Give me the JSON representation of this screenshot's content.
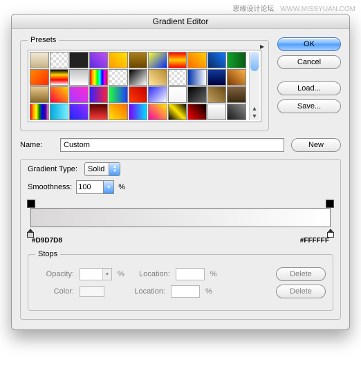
{
  "watermark": {
    "cn": "思缘设计论坛",
    "url": "WWW.MISSYUAN.COM"
  },
  "title": "Gradient Editor",
  "presets_label": "Presets",
  "buttons": {
    "ok": "OK",
    "cancel": "Cancel",
    "load": "Load...",
    "save": "Save...",
    "new": "New",
    "delete": "Delete"
  },
  "name_label": "Name:",
  "name_value": "Custom",
  "gt_label": "Gradient Type:",
  "gt_value": "Solid",
  "smooth_label": "Smoothness:",
  "smooth_value": "100",
  "pct": "%",
  "left_hex": "#D9D7D8",
  "right_hex": "#FFFFFF",
  "stops_label": "Stops",
  "opacity_label": "Opacity:",
  "color_label": "Color:",
  "location_label": "Location:",
  "swatches": [
    "linear-gradient(#f2e9d7,#c7b386)",
    "repeating-conic-gradient(#fff 0 25%,#ddd 0 50%) 0/8px 8px",
    "linear-gradient(#222,#222)",
    "linear-gradient(45deg,#5a2de0,#c64ef0)",
    "linear-gradient(45deg,#ff9a00,#ffe200)",
    "linear-gradient(#aa7f1a,#6a4500)",
    "linear-gradient(135deg,#ffff33,#002aff)",
    "linear-gradient(#ff0000,#ffcc00,#ff0000)",
    "linear-gradient(45deg,#ff6a00,#ffd000)",
    "linear-gradient(45deg,#0a2a60,#1478ff)",
    "linear-gradient(90deg,#13a02a,#0a5a16)",
    "linear-gradient(135deg,#ff8a00,#ff2d00)",
    "linear-gradient(#000,#ffd800,#f00,#fff)",
    "linear-gradient(#c0c0c0,#fff)",
    "linear-gradient(90deg,red,orange,yellow,lime,cyan,blue,magenta,red)",
    "repeating-conic-gradient(#fff 0 25%,#ddd 0 50%) 0/8px 8px",
    "linear-gradient(135deg,#000,#fff)",
    "linear-gradient(45deg,#ffe6a0,#b98b2c)",
    "repeating-conic-gradient(#fff 0 25%,#ddd 0 50%) 0/8px 8px",
    "linear-gradient(90deg,#0033aa,#fff)",
    "linear-gradient(#103a9a,#000040)",
    "linear-gradient(45deg,#7a3a00,#ffb24d)",
    "linear-gradient(#e6c68a,#8a6a2a)",
    "linear-gradient(45deg,#ff0040,#ffd200)",
    "linear-gradient(45deg,#a63aff,#ff2ad4)",
    "linear-gradient(90deg,#3a1fff,#ff1f3a)",
    "linear-gradient(90deg,#1fff3a,#1f3aff)",
    "linear-gradient(45deg,#ff3a00,#c40000)",
    "linear-gradient(135deg,#2a2aff,#fff)",
    "linear-gradient(#fff,#f5f5f5)",
    "linear-gradient(135deg,#000,#666)",
    "linear-gradient(45deg,#c0a060,#6b4a12)",
    "linear-gradient(#806040,#3a2a10)",
    "linear-gradient(90deg,red,orange,yellow,green,blue,indigo,violet)",
    "linear-gradient(90deg,#0ad,#7ef)",
    "linear-gradient(45deg,#1a2aff,#9a2aff)",
    "linear-gradient(#5a0000,#ff3a3a)",
    "linear-gradient(45deg,#ffe400,#ff6a00)",
    "linear-gradient(90deg,#7a00ff,#00e0ff)",
    "linear-gradient(45deg,#ff00aa,#ffea00)",
    "linear-gradient(45deg,#000,#ffe400,#000)",
    "linear-gradient(45deg,#ff0000,#000)",
    "linear-gradient(#fff,#ddd)",
    "linear-gradient(45deg,#1a1a1a,#888)"
  ]
}
